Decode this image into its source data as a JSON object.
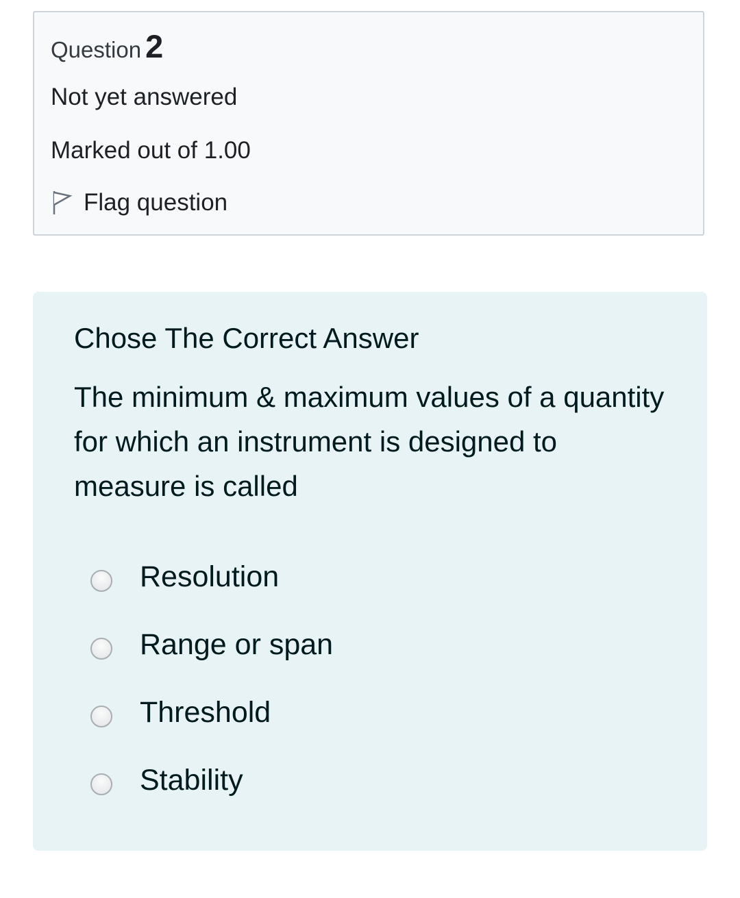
{
  "question_info": {
    "label": "Question",
    "number": "2",
    "state": "Not yet answered",
    "grade": "Marked out of 1.00",
    "flag_label": "Flag question",
    "flag_icon": "flag-outline-icon"
  },
  "question": {
    "instruction": "Chose The Correct Answer",
    "text": "The minimum & maximum values of a quantity for which an instrument is designed to measure is called",
    "answers": [
      {
        "label": "Resolution",
        "selected": false
      },
      {
        "label": "Range or span",
        "selected": false
      },
      {
        "label": "Threshold",
        "selected": false
      },
      {
        "label": "Stability",
        "selected": false
      }
    ]
  },
  "colors": {
    "info_background": "#f8f9fa",
    "info_border": "#ced4da",
    "content_background": "#e7f3f5",
    "text": "#1d2125"
  }
}
